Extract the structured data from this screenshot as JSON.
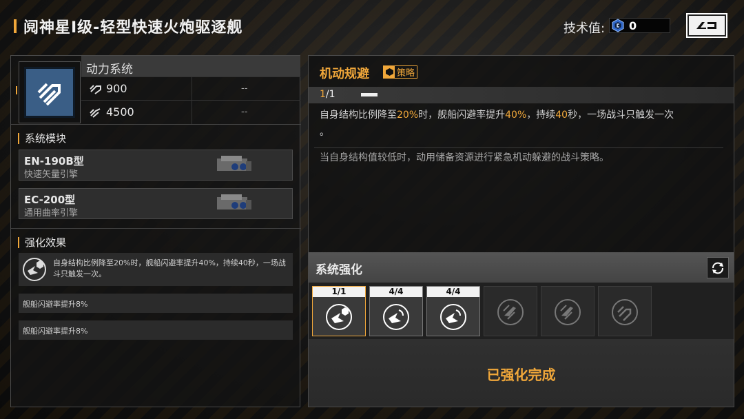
{
  "header": {
    "title": "阋神星Ⅰ级-轻型快速火炮驱逐舰",
    "tech_label": "技术值:",
    "tech_value": "0",
    "back_icon": "back-arrow-icon"
  },
  "system": {
    "name": "动力系统",
    "icon": "engine-boost-icon",
    "stats": [
      {
        "icon": "speed-icon",
        "value": "900",
        "extra": "--"
      },
      {
        "icon": "thrust-icon",
        "value": "4500",
        "extra": "--"
      }
    ]
  },
  "modules": {
    "title": "系统模块",
    "items": [
      {
        "name": "EN-190B型",
        "desc": "快速矢量引擎"
      },
      {
        "name": "EC-200型",
        "desc": "通用曲率引擎"
      }
    ]
  },
  "effects": {
    "title": "强化效果",
    "main": "自身结构比例降至20%时，舰船闪避率提升40%，持续40秒，一场战斗只触发一次。",
    "rows": [
      "舰船闪避率提升8%",
      "舰船闪避率提升8%"
    ]
  },
  "skill": {
    "name": "机动规避",
    "tag": "策略",
    "level_cur": "1",
    "level_sep": "/1",
    "desc_p1": "自身结构比例降至",
    "desc_v1": "20%",
    "desc_p2": "时，舰船闪避率提升",
    "desc_v2": "40%",
    "desc_p3": "，持续",
    "desc_v3": "40",
    "desc_p4": "秒，一场战斗只触发一次",
    "desc_p5": "。",
    "lore": "当自身结构值较低时，动用储备资源进行紧急机动躲避的战斗策略。"
  },
  "enhance": {
    "title": "系统强化",
    "slots": [
      {
        "count": "1/1",
        "icon": "evade-strategy-icon",
        "state": "active"
      },
      {
        "count": "4/4",
        "icon": "evade-icon",
        "state": "done"
      },
      {
        "count": "4/4",
        "icon": "evade-icon",
        "state": "done"
      },
      {
        "count": "",
        "icon": "locked-evade-icon",
        "state": "locked"
      },
      {
        "count": "",
        "icon": "locked-evade-icon",
        "state": "locked"
      },
      {
        "count": "",
        "icon": "locked-boost-icon",
        "state": "locked"
      }
    ],
    "complete_text": "已强化完成"
  },
  "colors": {
    "accent": "#f0a73a",
    "panel": "#1a1a1a",
    "icon_blue": "#3a5e86"
  }
}
